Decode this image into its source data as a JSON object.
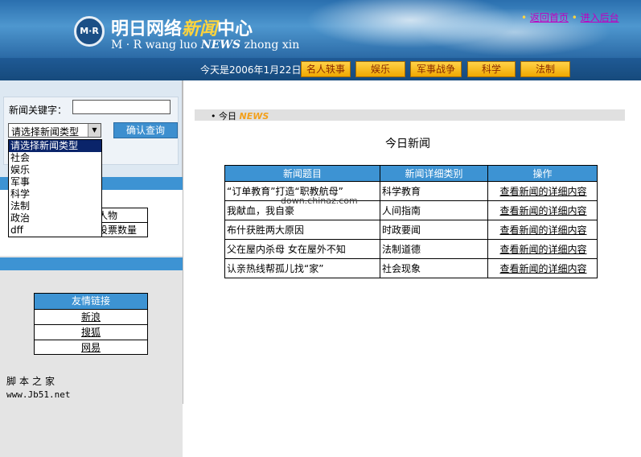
{
  "header": {
    "logo_text": "M·R",
    "title_a": "明日网络",
    "title_b": "新闻",
    "title_c": "中心",
    "sub_a": "M · R wang luo",
    "sub_b": "NEWS",
    "sub_c": "zhong xin",
    "link_home": "返回首页",
    "link_admin": "进入后台"
  },
  "nav": {
    "date": "今天是2006年1月22日",
    "items": [
      "名人轶事",
      "娱乐",
      "军事战争",
      "科学",
      "法制"
    ]
  },
  "search": {
    "keyword_label": "新闻关键字：",
    "keyword_value": "",
    "select_value": "请选择新闻类型",
    "confirm_label": "确认查询",
    "options": [
      "请选择新闻类型",
      "社会",
      "娱乐",
      "军事",
      "科学",
      "法制",
      "政治",
      "dff"
    ]
  },
  "sidebar": {
    "rank_rows": [
      "人物",
      "投票数量"
    ],
    "links_header": "友情链接",
    "links": [
      "新浪",
      "搜狐",
      "网易"
    ]
  },
  "footer": {
    "site_cn": "脚本之家",
    "site_url": "www.Jb51.net"
  },
  "main": {
    "section_label": "• 今日",
    "section_news": "NEWS",
    "title": "今日新闻",
    "watermark": "down.chinaz.com",
    "columns": [
      "新闻题目",
      "新闻详细类别",
      "操作"
    ],
    "rows": [
      {
        "title": "“订单教育”打造“职教航母”",
        "category": "科学教育",
        "action": "查看新闻的详细内容"
      },
      {
        "title": "我献血，我自豪",
        "category": "人间指南",
        "action": "查看新闻的详细内容"
      },
      {
        "title": "布什获胜两大原因",
        "category": "时政要闻",
        "action": "查看新闻的详细内容"
      },
      {
        "title": "父在屋内杀母 女在屋外不知",
        "category": "法制道德",
        "action": "查看新闻的详细内容"
      },
      {
        "title": "认亲热线帮孤儿找“家”",
        "category": "社会现象",
        "action": "查看新闻的详细内容"
      }
    ]
  },
  "colors": {
    "header_blue": "#2a6fae",
    "accent_blue": "#3d93d3",
    "nav_gold": "#f0a800",
    "link_purple": "#c000c0"
  }
}
